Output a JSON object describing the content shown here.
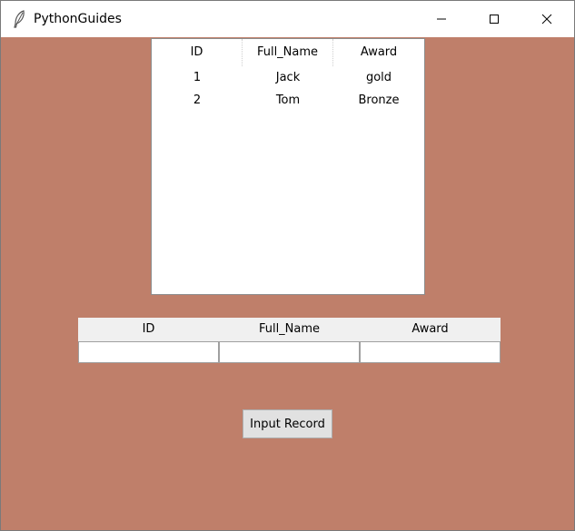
{
  "window": {
    "title": "PythonGuides",
    "icon": "feather-icon",
    "controls": [
      "minimize-icon",
      "maximize-icon",
      "close-icon"
    ],
    "background": "#bf7f6a"
  },
  "tree": {
    "columns": [
      "ID",
      "Full_Name",
      "Award"
    ],
    "rows": [
      [
        "1",
        "Jack",
        "gold"
      ],
      [
        "2",
        "Tom",
        "Bronze"
      ]
    ]
  },
  "entry_form": {
    "labels": [
      "ID",
      "Full_Name",
      "Award"
    ],
    "values": [
      "",
      "",
      ""
    ]
  },
  "button": {
    "label": "Input Record"
  }
}
